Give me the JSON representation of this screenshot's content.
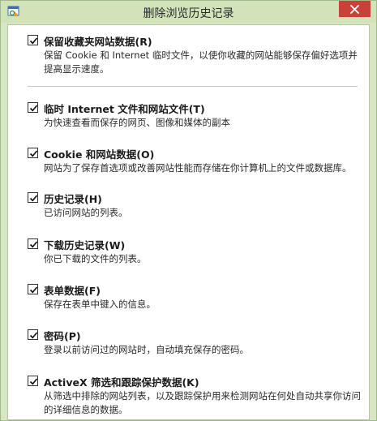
{
  "window": {
    "title": "删除浏览历史记录",
    "close_icon": "close-icon",
    "app_icon": "ie-history-icon"
  },
  "options": [
    {
      "label": "保留收藏夹网站数据(R)",
      "checked": true,
      "description": "保留 Cookie 和 Internet 临时文件，以使你收藏的网站能够保存偏好选项并提高显示速度。"
    },
    {
      "label": "临时 Internet 文件和网站文件(T)",
      "checked": true,
      "description": "为快速查看而保存的网页、图像和媒体的副本"
    },
    {
      "label": "Cookie 和网站数据(O)",
      "checked": true,
      "description": "网站为了保存首选项或改善网站性能而存储在你计算机上的文件或数据库。"
    },
    {
      "label": "历史记录(H)",
      "checked": true,
      "description": "已访问网站的列表。"
    },
    {
      "label": "下载历史记录(W)",
      "checked": true,
      "description": "你已下载的文件的列表。"
    },
    {
      "label": "表单数据(F)",
      "checked": true,
      "description": "保存在表单中键入的信息。"
    },
    {
      "label": "密码(P)",
      "checked": true,
      "description": "登录以前访问过的网站时，自动填充保存的密码。"
    },
    {
      "label": "ActiveX 筛选和跟踪保护数据(K)",
      "checked": true,
      "description": "从筛选中排除的网站列表，以及跟踪保护用来检测网站在何处自动共享你访问的详细信息的数据。"
    }
  ]
}
